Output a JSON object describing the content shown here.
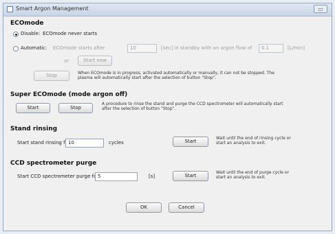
{
  "window": {
    "title": "Smart Argon Management",
    "close_glyph": "▭"
  },
  "ecomode": {
    "heading": "ECOmode",
    "disable_label": "Disable:",
    "disable_text": "ECOmode never starts",
    "automatic_label": "Automatic:",
    "auto_text1": "ECOmode starts after",
    "idle_value": "10",
    "auto_text2": "[sec] in standby with an argon flow of",
    "flow_value": "0.1",
    "flow_unit": "[L/min]",
    "or_text": "or",
    "start_now_label": "Start now",
    "stop_label": "Stop",
    "stop_desc": "When ECOmode is in progress, activated automatically or manually, it can not be stopped. The plasma will automatically start after the selection of button \"Stop\"."
  },
  "super": {
    "heading": "Super ECOmode (mode argon off)",
    "start_label": "Start",
    "stop_label": "Stop",
    "desc": "A procedure to rinse the stand and purge the CCD spectrometer will automatically start after the selection of button \"Stop\"."
  },
  "stand": {
    "heading": "Stand rinsing",
    "label": "Start stand rinsing for",
    "value": "10",
    "unit": "cycles",
    "start_label": "Start",
    "desc": "Wait until the end of rinsing cycle or start an analysis to exit."
  },
  "ccd": {
    "heading": "CCD spectrometer purge",
    "label": "Start CCD spectrometer purge for",
    "value": "5",
    "unit": "[s]",
    "start_label": "Start",
    "desc": "Wait until the end of purge cycle or start an analysis to exit."
  },
  "footer": {
    "ok_label": "OK",
    "cancel_label": "Cancel"
  }
}
